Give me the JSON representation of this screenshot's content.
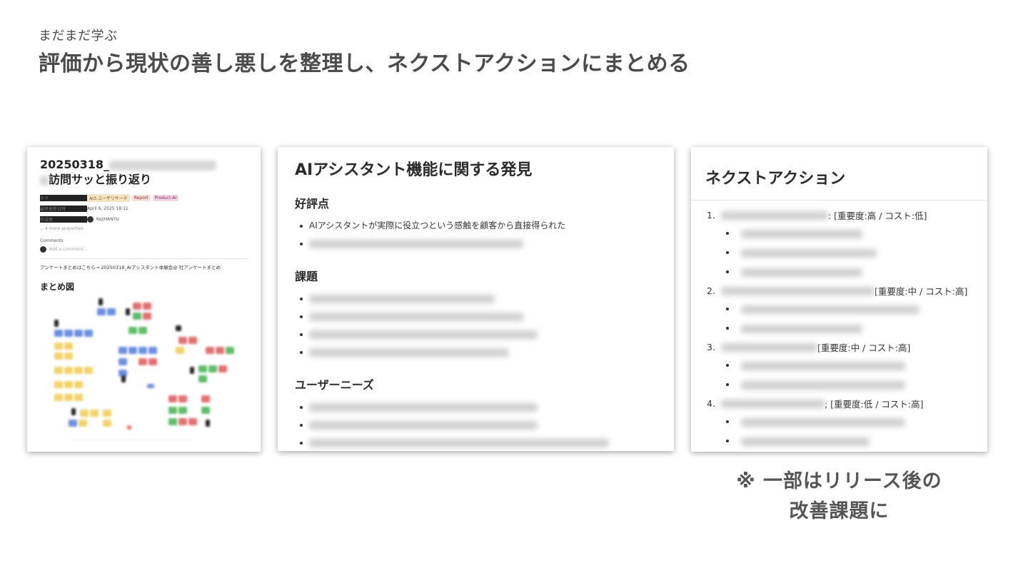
{
  "header": {
    "kicker": "まだまだ学ぶ",
    "title": "評価から現状の善し悪しを整理し、ネクストアクションにまとめる"
  },
  "card1": {
    "title_prefix": "20250318_",
    "title_line2": "訪問サッと振り返り",
    "props": [
      {
        "key": "タグ",
        "tags": [
          "Act-ユーザリサーチ",
          "Report",
          "Product-AI"
        ]
      },
      {
        "key": "最終更新日時",
        "value": "April 6, 2025 18:11"
      },
      {
        "key": "作成者",
        "value": "KojiHANYU"
      }
    ],
    "more": "4 more properties",
    "comments_label": "Comments",
    "comment_placeholder": "Add a comment...",
    "link_line": "アンケートまとめはこちら→ 20250318_AIアシスタント体験会@      社アンケートまとめ",
    "summary_heading": "まとめ図"
  },
  "card2": {
    "heading": "AIアシスタント機能に関する発見",
    "sections": [
      {
        "title": "好評点",
        "items": [
          "AIアシスタントが実際に役立つという感触を顧客から直接得られた"
        ]
      },
      {
        "title": "課題",
        "items": []
      },
      {
        "title": "ユーザーニーズ",
        "items": []
      }
    ]
  },
  "card3": {
    "heading": "ネクストアクション",
    "items": [
      {
        "num": "1.",
        "suffix": ": [重要度:高 / コスト:低]"
      },
      {
        "num": "2.",
        "suffix": "[重要度:中 / コスト:高]"
      },
      {
        "num": "3.",
        "suffix": "[重要度:中 / コスト:高]"
      },
      {
        "num": "4.",
        "suffix": "; [重要度:低 / コスト:高]"
      }
    ]
  },
  "note": {
    "line1": "※ 一部はリリース後の",
    "line2": "改善課題に"
  }
}
